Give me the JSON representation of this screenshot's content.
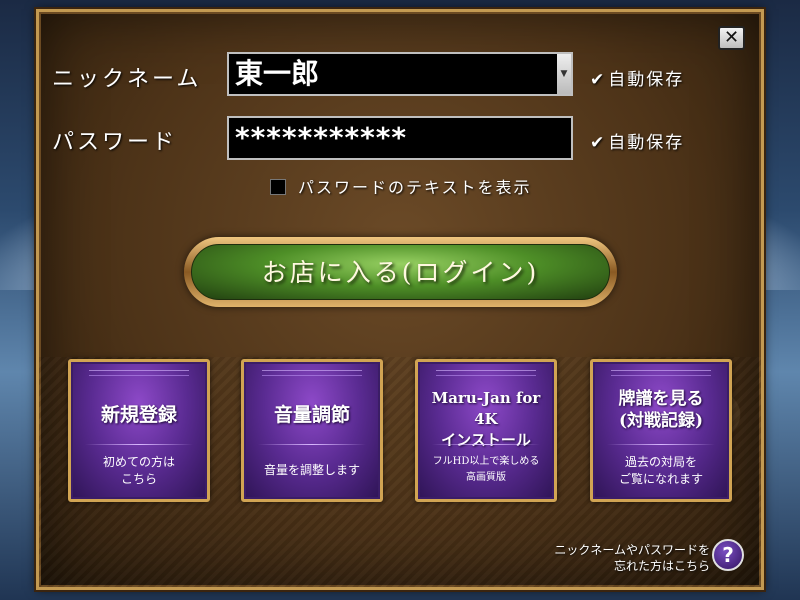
{
  "login_form": {
    "nickname_label": "ニックネーム",
    "nickname_value": "東一郎",
    "password_label": "パスワード",
    "password_value": "***********",
    "autosave_label": "自動保存",
    "show_password_label": "パスワードのテキストを表示",
    "login_button": "お店に入る(ログイン)",
    "close_icon": "close-icon"
  },
  "tiles": [
    {
      "title_line1": "新規登録",
      "title_line2": "",
      "sub_line1": "初めての方は",
      "sub_line2": "こちら"
    },
    {
      "title_line1": "音量調節",
      "title_line2": "",
      "sub_line1": "音量を調整します",
      "sub_line2": ""
    },
    {
      "title_line1": "Maru-Jan for 4K",
      "title_line2": "インストール",
      "sub_line1": "フルHD以上で楽しめる",
      "sub_line2": "高画質版"
    },
    {
      "title_line1": "牌譜を見る",
      "title_line2": "(対戦記録)",
      "sub_line1": "過去の対局を",
      "sub_line2": "ご覧になれます"
    }
  ],
  "help": {
    "line1": "ニックネームやパスワードを",
    "line2": "忘れた方はこちら",
    "icon": "question-icon"
  },
  "colors": {
    "panel": "#4d3318",
    "gold_border": "#c39a52",
    "login_green": "#4e8f27",
    "tile_purple": "#5a2b92"
  }
}
